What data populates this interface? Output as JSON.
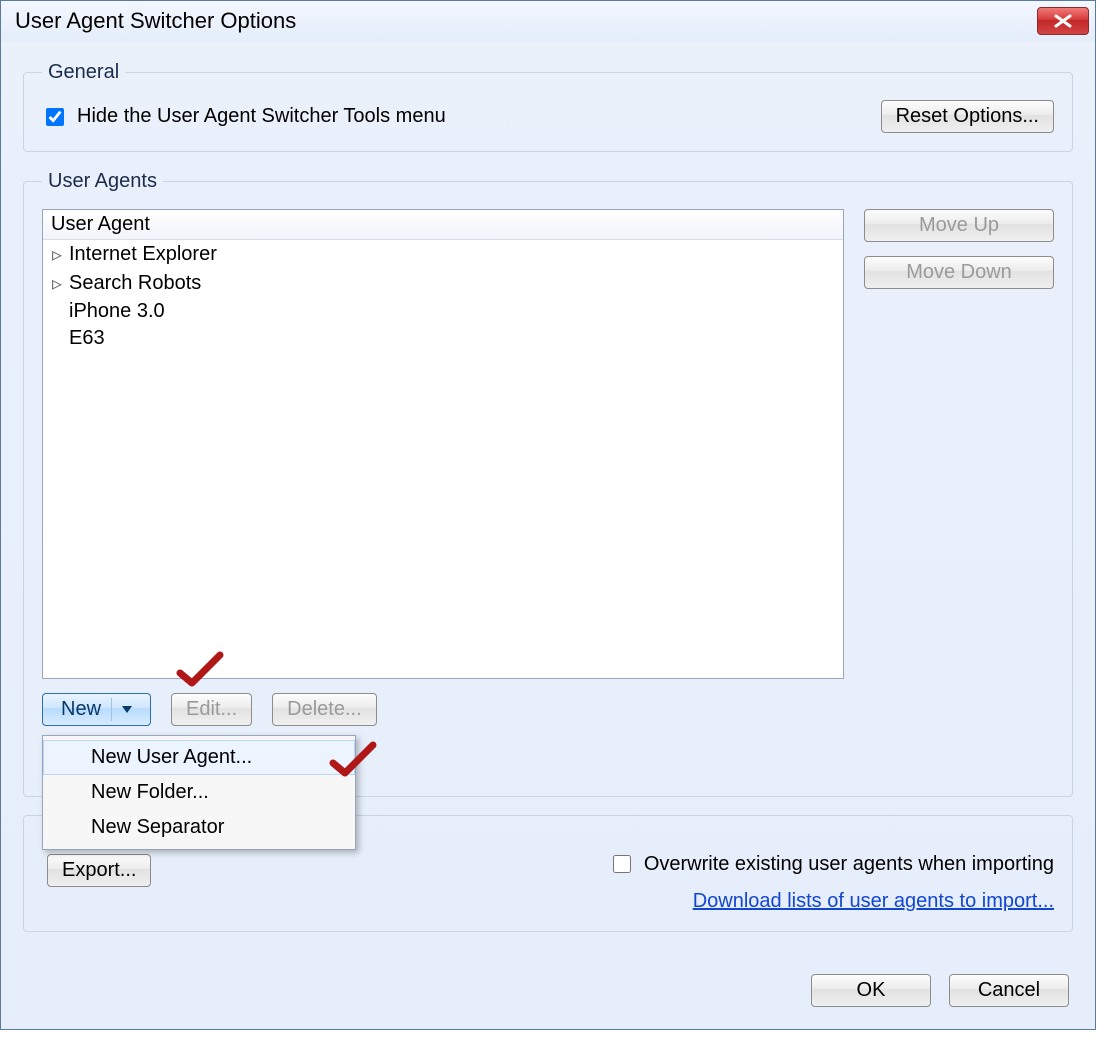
{
  "window": {
    "title": "User Agent Switcher Options"
  },
  "general": {
    "legend": "General",
    "hide_label": "Hide the User Agent Switcher Tools menu",
    "hide_checked": true,
    "reset_label": "Reset Options..."
  },
  "userAgents": {
    "legend": "User Agents",
    "column_header": "User Agent",
    "items": [
      {
        "label": "Internet Explorer",
        "expandable": true
      },
      {
        "label": "Search Robots",
        "expandable": true
      },
      {
        "label": "iPhone 3.0",
        "expandable": false
      },
      {
        "label": "E63",
        "expandable": false
      }
    ],
    "move_up": "Move Up",
    "move_down": "Move Down",
    "new": "New",
    "edit": "Edit...",
    "delete": "Delete...",
    "menu": {
      "new_user_agent": "New User Agent...",
      "new_folder": "New Folder...",
      "new_separator": "New Separator"
    }
  },
  "importExport": {
    "export": "Export...",
    "overwrite_label": "Overwrite existing user agents when importing",
    "overwrite_checked": false,
    "download_link": "Download lists of user agents to import..."
  },
  "footer": {
    "ok": "OK",
    "cancel": "Cancel"
  }
}
